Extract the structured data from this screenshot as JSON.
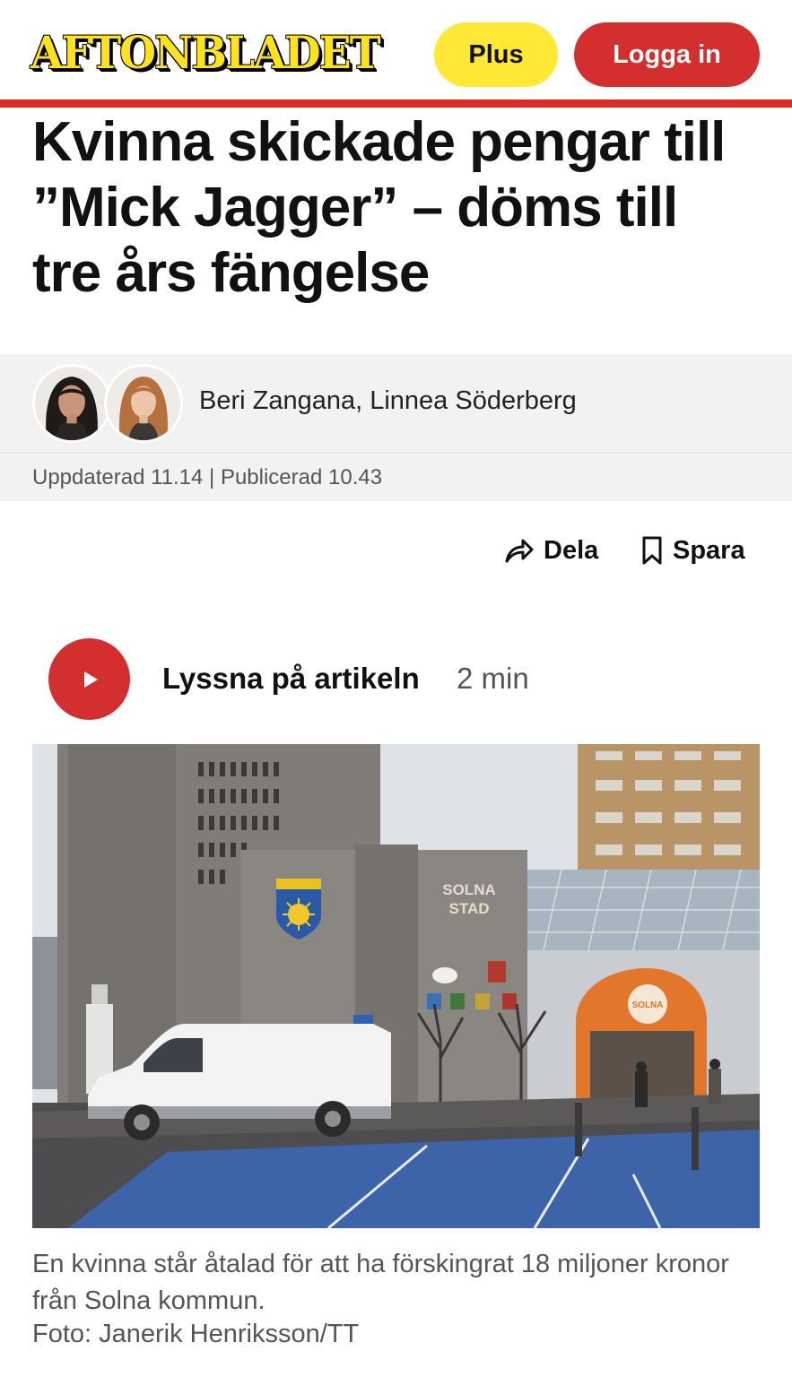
{
  "header": {
    "logo_text": "AFTONBLADET",
    "plus_label": "Plus",
    "login_label": "Logga in"
  },
  "article": {
    "headline": "Kvinna skickade pengar till ”Mick Jagger” – döms till tre års fängelse",
    "authors": "Beri Zangana, Linnea Söderberg",
    "dateline": "Uppdaterad 11.14 | Publicerad 10.43",
    "share_label": "Dela",
    "save_label": "Spara",
    "listen_label": "Lyssna på artikeln",
    "listen_duration": "2 min",
    "image": {
      "sign_text_line1": "SOLNA",
      "sign_text_line2": "STAD",
      "round_sign_text": "SOLNA",
      "caption": "En kvinna står åtalad för att ha förskingrat 18 miljoner kronor från Solna kommun.",
      "credit": "Foto: Janerik Henriksson/TT"
    }
  },
  "icons": [
    "share-arrow-icon",
    "bookmark-icon",
    "play-icon"
  ],
  "colors": {
    "brand_red": "#d32f2f",
    "brand_yellow": "#ffe936",
    "header_rule": "#df2b25"
  }
}
